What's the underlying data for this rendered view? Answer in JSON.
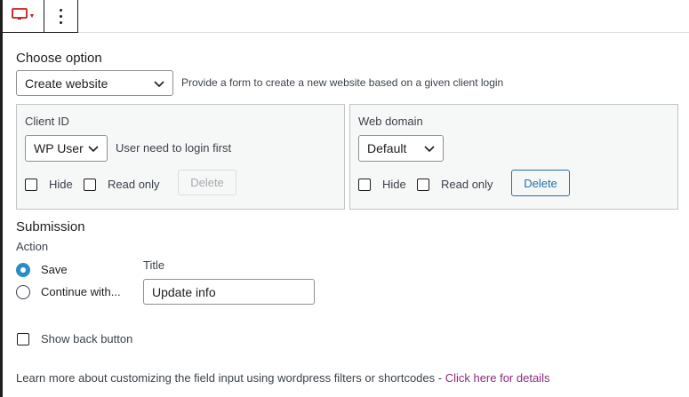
{
  "toolbar": {
    "block_icon": "desktop-icon",
    "more_icon": "more-vertical-icon"
  },
  "choose_option": {
    "heading": "Choose option",
    "selected": "Create website",
    "description": "Provide a form to create a new website based on a given client login"
  },
  "client_id_panel": {
    "label": "Client ID",
    "select_value": "WP User",
    "note": "User need to login first",
    "hide_label": "Hide",
    "read_only_label": "Read only",
    "delete_label": "Delete",
    "delete_disabled": true
  },
  "web_domain_panel": {
    "label": "Web domain",
    "select_value": "Default",
    "hide_label": "Hide",
    "read_only_label": "Read only",
    "delete_label": "Delete"
  },
  "submission": {
    "heading": "Submission",
    "action_label": "Action",
    "options": [
      "Save",
      "Continue with..."
    ],
    "selected_option": "Save",
    "title_label": "Title",
    "title_value": "Update info"
  },
  "show_back_button": {
    "label": "Show back button",
    "checked": false
  },
  "footer": {
    "text": "Learn more about customizing the field input using wordpress filters or shortcodes - ",
    "link_text": "Click here for details"
  },
  "colors": {
    "accent_blue": "#2271b1",
    "radio_blue": "#2a8ec5",
    "icon_red": "#cc1818",
    "link_purple": "#8a2a7f"
  }
}
